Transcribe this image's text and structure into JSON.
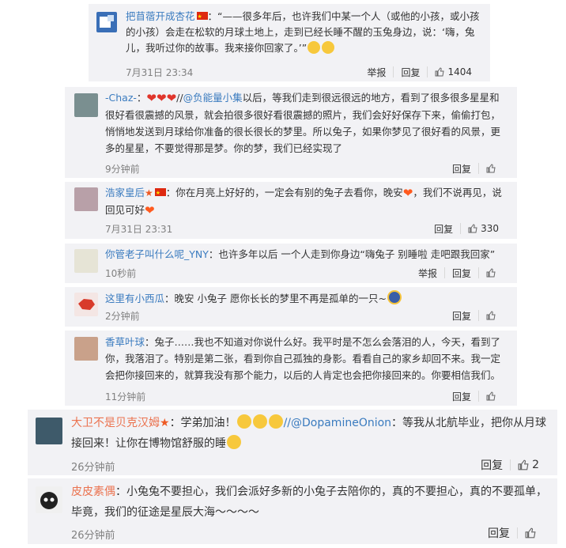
{
  "comments": [
    {
      "user": "把苜蓿开成杏花",
      "text": "“——很多年后，也许我们中某一个人（或他的小孩，或小孩的小孩）会走在松软的月球土地上，走到已经长睡不醒的玉兔身边，说：‘嗨，兔儿，我听过你的故事。我来接你回家了。’”",
      "time": "7月31日 23:34",
      "report": "举报",
      "reply": "回复",
      "likes": "1404"
    },
    {
      "user": "-Chaz-",
      "mention": "@负能量小集",
      "text": "以后，等我们走到很远很远的地方，看到了很多很多星星和很好看很震撼的风景，就会拍很多很好看很震撼的照片，我们会好好保存下来，偷偷打包，悄悄地发送到月球给你准备的很长很长的梦里。所以兔子，如果你梦见了很好看的风景，更多的星星，不要觉得那是梦。你的梦，我们已经实现了",
      "time": "9分钟前",
      "reply": "回复"
    },
    {
      "user": "浩家皇后",
      "text_a": "：你在月亮上好好的，一定会有别的兔子去看你，晚安",
      "text_b": "，我们不说再见，说回见可好",
      "time": "7月31日 23:31",
      "reply": "回复",
      "likes": "330"
    },
    {
      "user": "你管老子叫什么呢_YNY",
      "text": "：也许多年以后 一个人走到你身边“嗨兔子 别睡啦 走吧跟我回家”",
      "time": "10秒前",
      "report": "举报",
      "reply": "回复"
    },
    {
      "user": "这里有小西瓜",
      "text": "：晚安 小兔子 愿你长长的梦里不再是孤单的一只~",
      "time": "2分钟前",
      "reply": "回复"
    },
    {
      "user": "香草叶球",
      "text": "：兔子……我也不知道对你说什么好。我平时是不怎么会落泪的人，今天，看到了你，我落泪了。特别是第二张，看到你自己孤独的身影。看看自己的家乡却回不来。我一定会把你接回来的，就算我没有那个能力，以后的人肯定也会把你接回来的。你要相信我们。",
      "time": "11分钟前",
      "reply": "回复"
    },
    {
      "user": "大卫不是贝克汉姆",
      "text_a": "：学弟加油！",
      "mention": "//@DopamineOnion",
      "text_b": "：等我从北航毕业，把你从月球接回来！让你在博物馆舒服的睡",
      "time": "26分钟前",
      "reply": "回复",
      "likes": "2"
    },
    {
      "user": "皮皮素偶",
      "text": "：小兔兔不要担心，我们会派好多新的小兔子去陪你的，真的不要担心，真的不要孤单，毕竟，我们的征途是星辰大海～～～～",
      "time": "26分钟前",
      "reply": "回复"
    }
  ],
  "icons": {
    "like": "thumbs-up-icon",
    "vip": "red-flag-icon",
    "heart": "heart-emoji-icon",
    "cry": "crying-emoji-icon"
  },
  "colors": {
    "nickname": "#eb7350",
    "link": "#3a7bbf",
    "meta": "#808080",
    "card": "#f2f2f5"
  }
}
